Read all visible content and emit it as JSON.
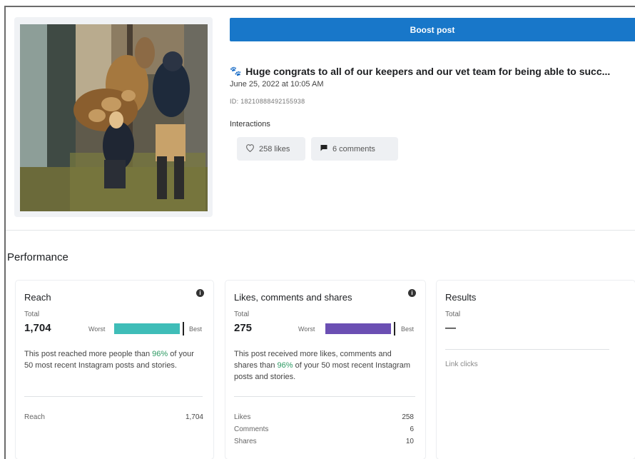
{
  "post": {
    "boost_label": "Boost post",
    "caption": "Huge congrats to all of our keepers and our vet team for being able to succ...",
    "date": "June 25, 2022 at 10:05 AM",
    "id": "ID: 18210888492155938",
    "interactions_label": "Interactions",
    "likes_label": "258 likes",
    "comments_label": "6 comments"
  },
  "performance": {
    "title": "Performance",
    "reach": {
      "title": "Reach",
      "total_label": "Total",
      "total_value": "1,704",
      "worst_label": "Worst",
      "best_label": "Best",
      "fill_fraction": 0.96,
      "bar_color": "#3fbdb8",
      "desc_pre": "This post reached more people than ",
      "desc_pct": "96%",
      "desc_post": " of your 50 most recent Instagram posts and stories.",
      "rows": [
        {
          "label": "Reach",
          "value": "1,704"
        }
      ]
    },
    "engagement": {
      "title": "Likes, comments and shares",
      "total_label": "Total",
      "total_value": "275",
      "worst_label": "Worst",
      "best_label": "Best",
      "fill_fraction": 0.96,
      "bar_color": "#6b4fb3",
      "desc_pre": "This post received more likes, comments and shares than ",
      "desc_pct": "96%",
      "desc_post": " of your 50 most recent Instagram posts and stories.",
      "rows": [
        {
          "label": "Likes",
          "value": "258"
        },
        {
          "label": "Comments",
          "value": "6"
        },
        {
          "label": "Shares",
          "value": "10"
        }
      ]
    },
    "results": {
      "title": "Results",
      "total_label": "Total",
      "total_value": "—",
      "link_clicks": "Link clicks"
    }
  }
}
